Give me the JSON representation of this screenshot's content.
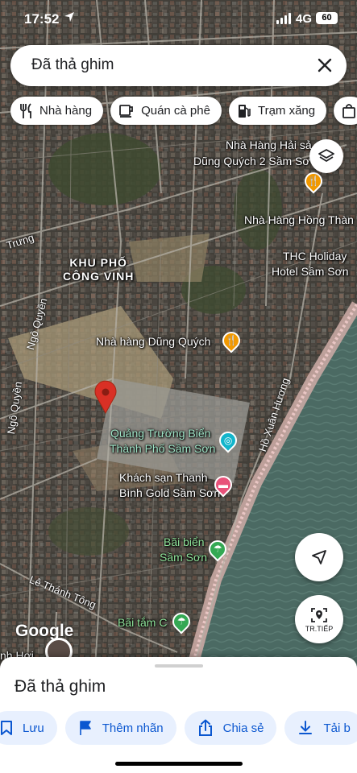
{
  "status": {
    "time": "17:52",
    "network": "4G",
    "battery": "60"
  },
  "search": {
    "query": "Đã thả ghim"
  },
  "chips": [
    {
      "icon": "fork-knife-icon",
      "label": "Nhà hàng"
    },
    {
      "icon": "coffee-cup-icon",
      "label": "Quán cà phê"
    },
    {
      "icon": "gas-pump-icon",
      "label": "Trạm xăng"
    },
    {
      "icon": "shopping-bag-icon",
      "label": ""
    }
  ],
  "map": {
    "places": {
      "nha_hang_hai_san": "Nhà Hàng Hải sả",
      "dung_quych_2": "Dũng Quých 2 Sầm Sơ",
      "nha_hang_hong_thanh": "Nhà Hàng Hồng Thàn",
      "thc_holiday_1": "THC Holiday",
      "thc_holiday_2": "Hotel Sầm Sơn",
      "dung_quych": "Nhà hàng Dũng Quých",
      "quang_truong_1": "Quảng Trường Biển",
      "quang_truong_2": "Thành Phố Sầm Sơn",
      "khach_san_1": "Khách sạn Thanh",
      "khach_san_2": "Bình Gold Sầm Sơn",
      "bai_bien_1": "Bãi biển",
      "bai_bien_2": "Sầm Sơn",
      "bai_tam": "Bãi tắm C",
      "area_1": "KHU PHỐ",
      "area_2": "CÔNG VINH",
      "nh_hoi": "nh Hơi"
    },
    "streets": {
      "trung": "Trưng",
      "ngo_quyen_1": "Ngô Quyền",
      "ngo_quyen_2": "Ngô Quyền",
      "ho_xuan_huong": "Hồ Xuân Hương",
      "le_thanh_tong": "Lê Thánh Tông"
    },
    "logo": "Google"
  },
  "buttons": {
    "next_label": "TR.TIẾP"
  },
  "sheet": {
    "title": "Đã thả ghim",
    "actions": [
      {
        "icon": "bookmark-icon",
        "label": "Lưu"
      },
      {
        "icon": "flag-icon",
        "label": "Thêm nhãn"
      },
      {
        "icon": "share-icon",
        "label": "Chia sẻ"
      },
      {
        "icon": "download-icon",
        "label": "Tải b"
      }
    ]
  },
  "colors": {
    "accent": "#0b57d0",
    "pin": "#d93025",
    "poi_food": "#f29900",
    "poi_hotel": "#e8527a",
    "poi_park": "#34a853",
    "poi_landmark": "#12b5cb"
  }
}
